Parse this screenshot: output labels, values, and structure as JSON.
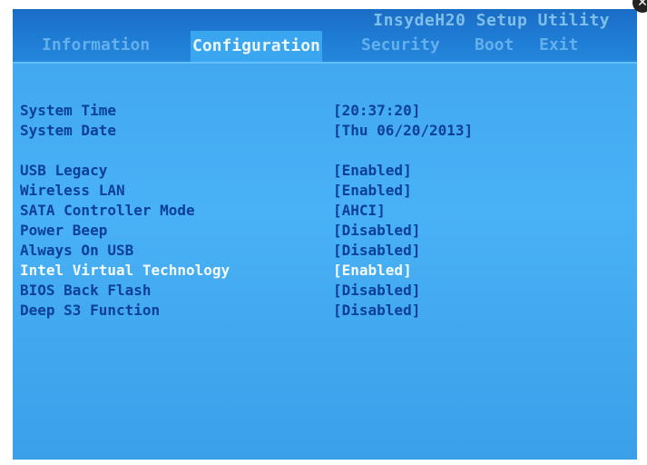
{
  "app_title": "InsydeH20 Setup Utility",
  "tabs": [
    {
      "label": "Information"
    },
    {
      "label": "Configuration"
    },
    {
      "label": "Security"
    },
    {
      "label": "Boot"
    },
    {
      "label": "Exit"
    }
  ],
  "active_tab": "Configuration",
  "settings": [
    {
      "label": "System Time",
      "value": "[20:37:20]"
    },
    {
      "label": "System Date",
      "value": "[Thu 06/20/2013]"
    },
    {
      "label": "USB Legacy",
      "value": "[Enabled]"
    },
    {
      "label": "Wireless LAN",
      "value": "[Enabled]"
    },
    {
      "label": "SATA Controller Mode",
      "value": "[AHCI]"
    },
    {
      "label": "Power Beep",
      "value": "[Disabled]"
    },
    {
      "label": "Always On USB",
      "value": "[Disabled]"
    },
    {
      "label": "Intel Virtual Technology",
      "value": "[Enabled]"
    },
    {
      "label": "BIOS Back Flash",
      "value": "[Disabled]"
    },
    {
      "label": "Deep S3 Function",
      "value": "[Disabled]"
    }
  ],
  "highlighted_setting": "Intel Virtual Technology",
  "colors": {
    "background": "#49b1f5",
    "text": "#0b3f9a",
    "highlight_text": "#f4fbff",
    "tab_inactive": "#63b0ec"
  }
}
